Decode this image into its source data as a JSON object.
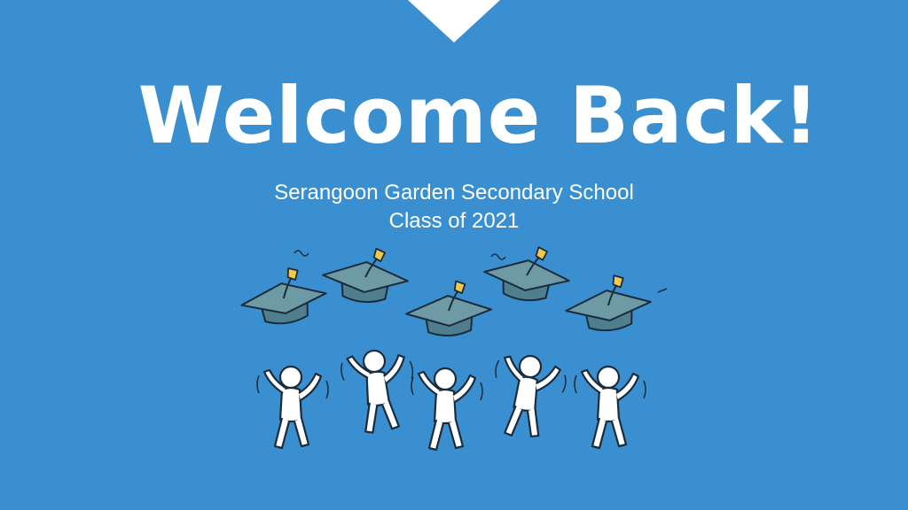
{
  "slide": {
    "title": "Welcome Back!",
    "subtitle_line1": "Serangoon Garden Secondary School",
    "subtitle_line2": "Class of 2021"
  },
  "colors": {
    "background": "#3a8fd0",
    "text": "#ffffff",
    "cap_face": "#6e9aa6",
    "cap_base": "#4f7f8e",
    "tassel": "#f2c84b",
    "outline": "#1b2b3a"
  },
  "illustration": {
    "icon": "graduates-celebration-icon",
    "caps": 5,
    "people": 5
  }
}
